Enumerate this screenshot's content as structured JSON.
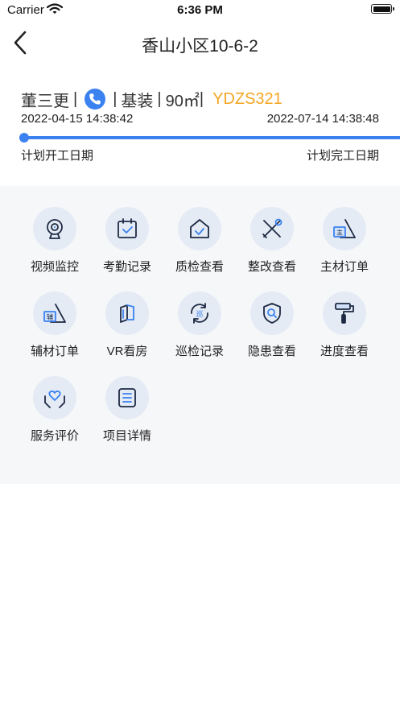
{
  "status": {
    "carrier": "Carrier",
    "time": "6:36 PM"
  },
  "nav": {
    "title": "香山小区10-6-2"
  },
  "project": {
    "owner": "董三更",
    "type": "基装",
    "area": "90㎡",
    "code": "YDZS321",
    "start_date": "2022-04-15 14:38:42",
    "end_date": "2022-07-14 14:38:48",
    "start_label": "计划开工日期",
    "end_label": "计划完工日期",
    "progress": 1.0
  },
  "menu": [
    {
      "label": "视频监控",
      "icon": "camera-icon"
    },
    {
      "label": "考勤记录",
      "icon": "calendar-check-icon"
    },
    {
      "label": "质检查看",
      "icon": "house-check-icon"
    },
    {
      "label": "整改查看",
      "icon": "tools-icon"
    },
    {
      "label": "主材订单",
      "icon": "main-material-icon"
    },
    {
      "label": "辅材订单",
      "icon": "aux-material-icon"
    },
    {
      "label": "VR看房",
      "icon": "vr-icon"
    },
    {
      "label": "巡检记录",
      "icon": "patrol-icon"
    },
    {
      "label": "隐患查看",
      "icon": "shield-search-icon"
    },
    {
      "label": "进度查看",
      "icon": "paint-roller-icon"
    },
    {
      "label": "服务评价",
      "icon": "heart-hands-icon"
    },
    {
      "label": "项目详情",
      "icon": "list-icon"
    }
  ],
  "colors": {
    "accent": "#3b82f0",
    "code": "#f5a623",
    "icon_bg": "#e4ebf5",
    "icon_stroke": "#1e2a44"
  }
}
